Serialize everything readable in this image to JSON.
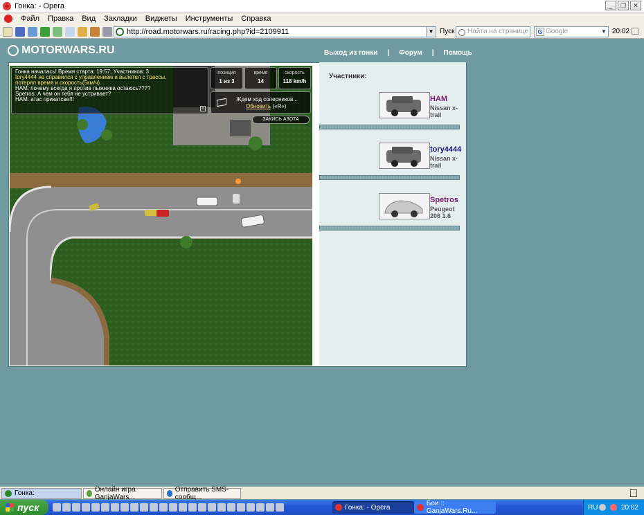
{
  "window": {
    "title": "Гонка: - Opera",
    "buttons": [
      "_",
      "❐",
      "✕"
    ]
  },
  "menu": [
    "Файл",
    "Правка",
    "Вид",
    "Закладки",
    "Виджеты",
    "Инструменты",
    "Справка"
  ],
  "toolbar": {
    "url": "http://road.motorwars.ru/racing.php?id=2109911",
    "go_label": "Пуск",
    "find_placeholder": "Найти на странице",
    "search_engine": "Google",
    "time": "20:02"
  },
  "site": {
    "logo": "MOTORWARS.RU",
    "nav": [
      "Выход из гонки",
      "Форум",
      "Помощь"
    ]
  },
  "game": {
    "chat_lines": [
      "Гонка началась! Время старта: 19:57, Участников: 3",
      "tory4444 не справился с управлением и вылетел с трассы,",
      "потерял время и скорость(5км/ч).",
      "НАМ: почему всегда я против лыжника остаюсь????",
      "Spetros: А чем он тебя не устривает?",
      "НАМ: атас прикатсве!!!"
    ],
    "stats": [
      {
        "caption": "позиция",
        "value": "1 из 3"
      },
      {
        "caption": "время",
        "value": "14"
      },
      {
        "caption": "скорость",
        "value": "118 km/h"
      }
    ],
    "wait_text": "Ждем ход соперников...",
    "refresh_link": "Обновить",
    "refresh_hint": "(«R»)",
    "nitro_button": "ЗАКИСЬ АЗОТА"
  },
  "participants": {
    "title": "Участники:",
    "players": [
      {
        "name": "НАМ",
        "car": "Nissan x-trail",
        "name_color": "#7a1a6e"
      },
      {
        "name": "tory4444",
        "car": "Nissan x-trail",
        "name_color": "#1a1a7a"
      },
      {
        "name": "Spetros",
        "car": "Peugeot 206 1.6",
        "name_color": "#7a1a6e"
      }
    ]
  },
  "windows_bar": {
    "tabs": [
      "Гонка:",
      "Онлайн игра GanjaWars...",
      "Отправить SMS-сообщ..."
    ]
  },
  "taskbar": {
    "start": "пуск",
    "tasks": [
      "Гонка: - Opera",
      "Бои :: GanjaWars.Ru..."
    ],
    "lang": "RU",
    "clock": "20:02"
  }
}
